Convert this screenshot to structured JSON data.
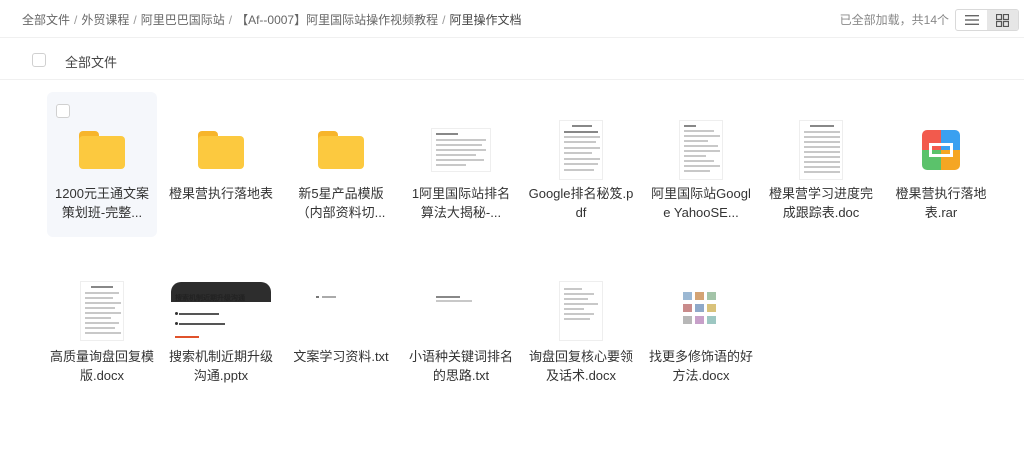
{
  "breadcrumb": {
    "items": [
      "全部文件",
      "外贸课程",
      "阿里巴巴国际站",
      "【Af--0007】阿里国际站操作视频教程"
    ],
    "current": "阿里操作文档",
    "separator": "/"
  },
  "status": {
    "count_text": "已全部加载，共14个"
  },
  "view_toggle": {
    "list_icon": "list-icon",
    "grid_icon": "grid-icon",
    "active": "grid"
  },
  "select_bar": {
    "label": "全部文件"
  },
  "files": [
    {
      "label": "1200元王通文案策划班-完整...",
      "icon": "folder-icon",
      "selected": true
    },
    {
      "label": "橙果营执行落地表",
      "icon": "folder-icon"
    },
    {
      "label": "新5星产品模版（内部资料切...",
      "icon": "folder-icon"
    },
    {
      "label": "1阿里国际站排名算法大揭秘-...",
      "icon": "document-thumbnail"
    },
    {
      "label": "Google排名秘笈.pdf",
      "icon": "pdf-thumbnail"
    },
    {
      "label": "阿里国际站Google YahooSE...",
      "icon": "document-thumbnail"
    },
    {
      "label": "橙果营学习进度完成跟踪表.doc",
      "icon": "document-thumbnail"
    },
    {
      "label": "橙果营执行落地表.rar",
      "icon": "rar-archive-icon"
    },
    {
      "label": "高质量询盘回复模版.docx",
      "icon": "document-thumbnail"
    },
    {
      "label": "搜索机制近期升级沟通.pptx",
      "icon": "slide-thumbnail",
      "slide_title": "搜索机制近期升级沟通"
    },
    {
      "label": "文案学习资料.txt",
      "icon": "text-thumbnail"
    },
    {
      "label": "小语种关键词排名的思路.txt",
      "icon": "text-thumbnail"
    },
    {
      "label": "询盘回复核心要领及话术.docx",
      "icon": "document-thumbnail"
    },
    {
      "label": "找更多修饰语的好方法.docx",
      "icon": "image-document-thumbnail"
    }
  ],
  "colors": {
    "folder": "#fcc93f",
    "folder_tab": "#f7b52b",
    "selected_bg": "#f5f7fb",
    "rar_red": "#f25a4d",
    "rar_blue": "#3aa0f0",
    "rar_green": "#5bc26b",
    "rar_orange": "#f5a623"
  }
}
